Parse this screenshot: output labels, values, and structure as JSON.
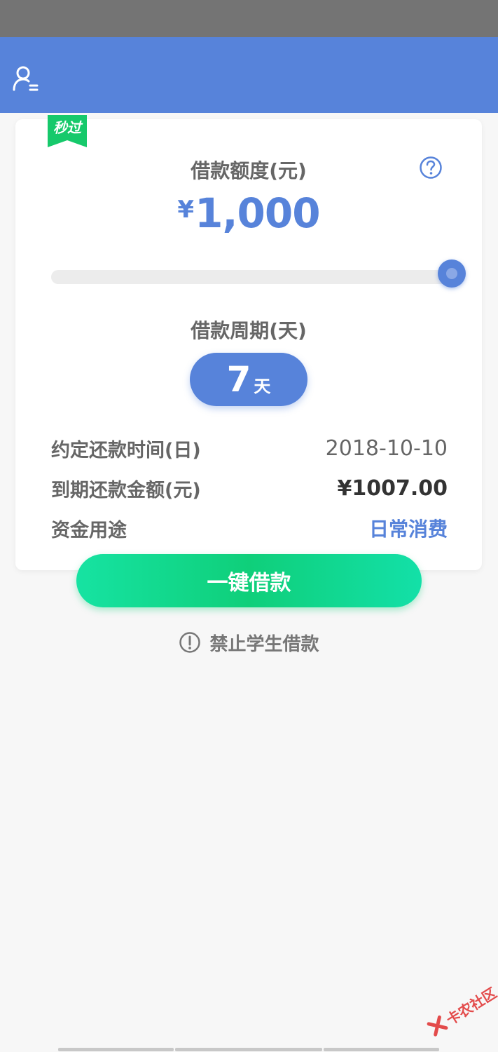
{
  "header": {
    "profile_icon": "user-profile-icon"
  },
  "card": {
    "ribbon_label": "秒过",
    "help_icon": "question-circle-icon",
    "amount_title": "借款额度(元)",
    "amount_currency": "¥",
    "amount_value": "1,000",
    "slider_level": 1.0,
    "period_title": "借款周期(天)",
    "period_value": "7",
    "period_unit": "天",
    "rows": [
      {
        "label": "约定还款时间(日)",
        "value": "2018-10-10"
      },
      {
        "label": "到期还款金额(元)",
        "value": "¥1007.00"
      },
      {
        "label": "资金用途",
        "value": "日常消费"
      }
    ]
  },
  "loan_button": "一键借款",
  "notice": {
    "icon": "exclamation-circle-icon",
    "text": "禁止学生借款"
  },
  "watermark": {
    "text": "卡农社区"
  },
  "colors": {
    "header_blue": "#5783da",
    "status_gray": "#747474",
    "green": "#0fcf7a",
    "background": "#f7f7f7"
  }
}
